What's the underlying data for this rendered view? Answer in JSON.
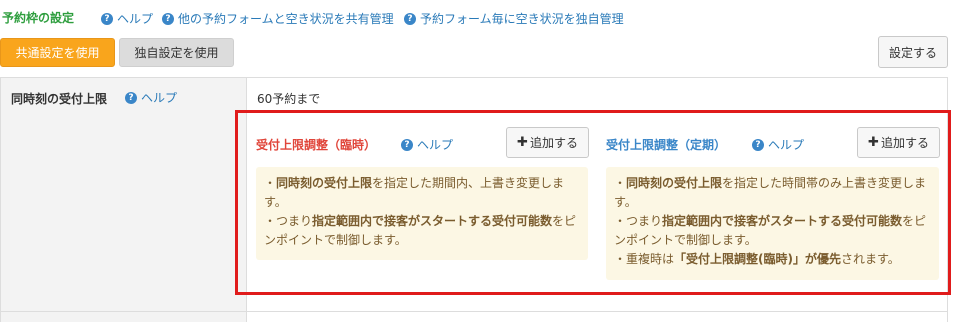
{
  "header": {
    "title": "予約枠の設定",
    "links": [
      "ヘルプ",
      "他の予約フォームと空き状況を共有管理",
      "予約フォーム毎に空き状況を独自管理"
    ]
  },
  "buttons": {
    "common": "共通設定を使用",
    "own": "独自設定を使用",
    "set": "設定する"
  },
  "row": {
    "label": "同時刻の受付上限",
    "help": "ヘルプ",
    "value": "60予約まで"
  },
  "panels": [
    {
      "title": "受付上限調整（臨時）",
      "help": "ヘルプ",
      "add": "追加する",
      "lines": [
        {
          "pre": "・",
          "b1": "同時刻の受付上限",
          "post": "を指定した期間内、上書き変更します。",
          "b2": "",
          "post2": ""
        },
        {
          "pre": "・つまり",
          "b1": "指定範囲内で接客がスタートする受付可能数",
          "post": "をピンポイントで制御します。",
          "b2": "",
          "post2": ""
        }
      ]
    },
    {
      "title": "受付上限調整（定期）",
      "help": "ヘルプ",
      "add": "追加する",
      "lines": [
        {
          "pre": "・",
          "b1": "同時刻の受付上限",
          "post": "を指定した時間帯のみ上書き変更します。",
          "b2": "",
          "post2": ""
        },
        {
          "pre": "・つまり",
          "b1": "指定範囲内で接客がスタートする受付可能数",
          "post": "をピンポイントで制御します。",
          "b2": "",
          "post2": ""
        },
        {
          "pre": "・重複時は",
          "b1": "「受付上限調整(臨時)」が優先",
          "post": "されます。",
          "b2": "",
          "post2": ""
        }
      ]
    }
  ],
  "colors": {
    "title_green": "#2e9e3e",
    "link_blue": "#2a7ab8",
    "orange_button": "#f9a51c",
    "highlight_red": "#e01b1b",
    "panel_red_title": "#e0453a",
    "panel_blue_title": "#3a86c8",
    "note_bg": "#fcf7e4"
  },
  "icons": {
    "help": "question-circle-icon",
    "add": "plus-icon"
  }
}
